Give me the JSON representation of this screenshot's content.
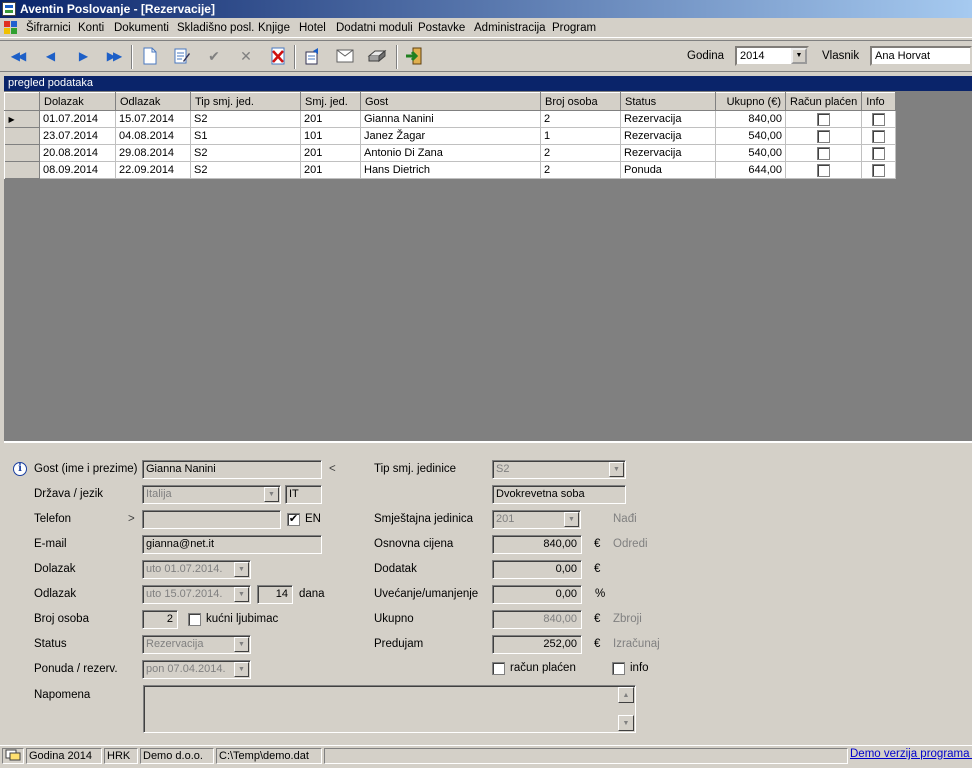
{
  "window": {
    "title": "Aventin Poslovanje - [Rezervacije]"
  },
  "menu": [
    "Šifrarnici",
    "Konti",
    "Dokumenti",
    "Skladišno posl.",
    "Knjige",
    "Hotel",
    "Dodatni moduli",
    "Postavke",
    "Administracija",
    "Program"
  ],
  "toolbar": {
    "year_label": "Godina",
    "year_value": "2014",
    "owner_label": "Vlasnik",
    "owner_value": "Ana Horvat",
    "buttons": [
      "first-record",
      "previous-record",
      "next-record",
      "last-record",
      "new-document",
      "edit",
      "confirm",
      "cancel",
      "delete",
      "export",
      "email",
      "print",
      "exit"
    ]
  },
  "grid": {
    "panel_title": "pregled podataka",
    "columns": [
      "Dolazak",
      "Odlazak",
      "Tip smj. jed.",
      "Smj. jed.",
      "Gost",
      "Broj osoba",
      "Status",
      "Ukupno (€)",
      "Račun plaćen",
      "Info"
    ],
    "rows": [
      {
        "dolazak": "01.07.2014",
        "odlazak": "15.07.2014",
        "tip": "S2",
        "smj": "201",
        "gost": "Gianna Nanini",
        "osoba": "2",
        "status": "Rezervacija",
        "ukupno": "840,00",
        "placen": false,
        "info": false,
        "current": true
      },
      {
        "dolazak": "23.07.2014",
        "odlazak": "04.08.2014",
        "tip": "S1",
        "smj": "101",
        "gost": "Janez Žagar",
        "osoba": "1",
        "status": "Rezervacija",
        "ukupno": "540,00",
        "placen": false,
        "info": false,
        "current": false
      },
      {
        "dolazak": "20.08.2014",
        "odlazak": "29.08.2014",
        "tip": "S2",
        "smj": "201",
        "gost": "Antonio Di Zana",
        "osoba": "2",
        "status": "Rezervacija",
        "ukupno": "540,00",
        "placen": false,
        "info": false,
        "current": false
      },
      {
        "dolazak": "08.09.2014",
        "odlazak": "22.09.2014",
        "tip": "S2",
        "smj": "201",
        "gost": "Hans Dietrich",
        "osoba": "2",
        "status": "Ponuda",
        "ukupno": "644,00",
        "placen": false,
        "info": false,
        "current": false
      }
    ]
  },
  "form": {
    "gost_label": "Gost (ime i prezime)",
    "gost_value": "Gianna Nanini",
    "gost_arrow": "<",
    "drzava_label": "Država / jezik",
    "drzava_value": "Italija",
    "jezik_value": "IT",
    "telefon_label": "Telefon",
    "telefon_arrow": ">",
    "telefon_value": "",
    "en_label": "EN",
    "en_checked": true,
    "email_label": "E-mail",
    "email_value": "gianna@net.it",
    "dolazak_label": "Dolazak",
    "dolazak_value": "uto 01.07.2014.",
    "odlazak_label": "Odlazak",
    "odlazak_value": "uto 15.07.2014.",
    "dana_value": "14",
    "dana_label": "dana",
    "osobe_label": "Broj osoba",
    "osobe_value": "2",
    "ljubimac_label": "kućni ljubimac",
    "status_label": "Status",
    "status_value": "Rezervacija",
    "ponuda_label": "Ponuda / rezerv.",
    "ponuda_value": "pon 07.04.2014.",
    "napomena_label": "Napomena",
    "tip_label": "Tip smj. jedinice",
    "tip_value": "S2",
    "tip_desc": "Dvokrevetna soba",
    "jedinica_label": "Smještajna jedinica",
    "jedinica_value": "201",
    "nadi_label": "Nađi",
    "cijena_label": "Osnovna cijena",
    "cijena_value": "840,00",
    "euro": "€",
    "odredi_label": "Odredi",
    "dodatak_label": "Dodatak",
    "dodatak_value": "0,00",
    "uvecanje_label": "Uvećanje/umanjenje",
    "uvecanje_value": "0,00",
    "percent": "%",
    "ukupno_label": "Ukupno",
    "ukupno_value": "840,00",
    "zbroji_label": "Zbroji",
    "predujam_label": "Predujam",
    "predujam_value": "252,00",
    "izracunaj_label": "Izračunaj",
    "placen_label": "račun plaćen",
    "info_label": "info"
  },
  "statusbar": {
    "godina": "Godina 2014",
    "valuta": "HRK",
    "firma": "Demo d.o.o.",
    "datoteka": "C:\\Temp\\demo.dat",
    "demo_link": "Demo verzija programa Po"
  }
}
